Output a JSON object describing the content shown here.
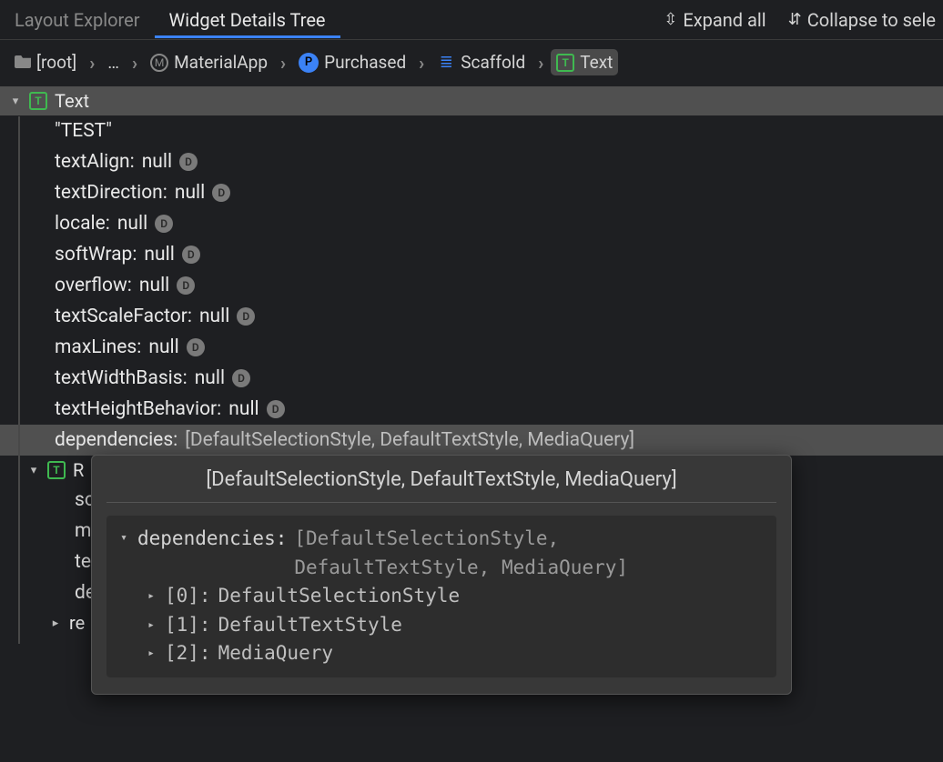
{
  "tabs": {
    "layout_explorer": "Layout Explorer",
    "widget_details": "Widget Details Tree",
    "expand_all": "Expand all",
    "collapse_to": "Collapse to sele"
  },
  "breadcrumb": {
    "root": "[root]",
    "ellipsis": "…",
    "material_app": "MaterialApp",
    "purchased": "Purchased",
    "scaffold": "Scaffold",
    "text": "Text"
  },
  "main_node": {
    "name": "Text",
    "value": "\"TEST\"",
    "props": [
      {
        "k": "textAlign:",
        "v": "null",
        "d": true
      },
      {
        "k": "textDirection:",
        "v": "null",
        "d": true
      },
      {
        "k": "locale:",
        "v": "null",
        "d": true
      },
      {
        "k": "softWrap:",
        "v": "null",
        "d": true
      },
      {
        "k": "overflow:",
        "v": "null",
        "d": true
      },
      {
        "k": "textScaleFactor:",
        "v": "null",
        "d": true
      },
      {
        "k": "maxLines:",
        "v": "null",
        "d": true
      },
      {
        "k": "textWidthBasis:",
        "v": "null",
        "d": true
      },
      {
        "k": "textHeightBehavior:",
        "v": "null",
        "d": true
      }
    ],
    "deps_key": "dependencies:",
    "deps_val": "[DefaultSelectionStyle, DefaultTextStyle, MediaQuery]"
  },
  "sub_node": {
    "name_first": "R",
    "props_first": [
      "so",
      "m",
      "te",
      "de"
    ],
    "collapsed": "re"
  },
  "popover": {
    "title": "[DefaultSelectionStyle, DefaultTextStyle, MediaQuery]",
    "key": "dependencies:",
    "val": "[DefaultSelectionStyle, DefaultTextStyle, MediaQuery]",
    "items": [
      {
        "idx": "[0]:",
        "v": "DefaultSelectionStyle"
      },
      {
        "idx": "[1]:",
        "v": "DefaultTextStyle"
      },
      {
        "idx": "[2]:",
        "v": "MediaQuery"
      }
    ]
  }
}
